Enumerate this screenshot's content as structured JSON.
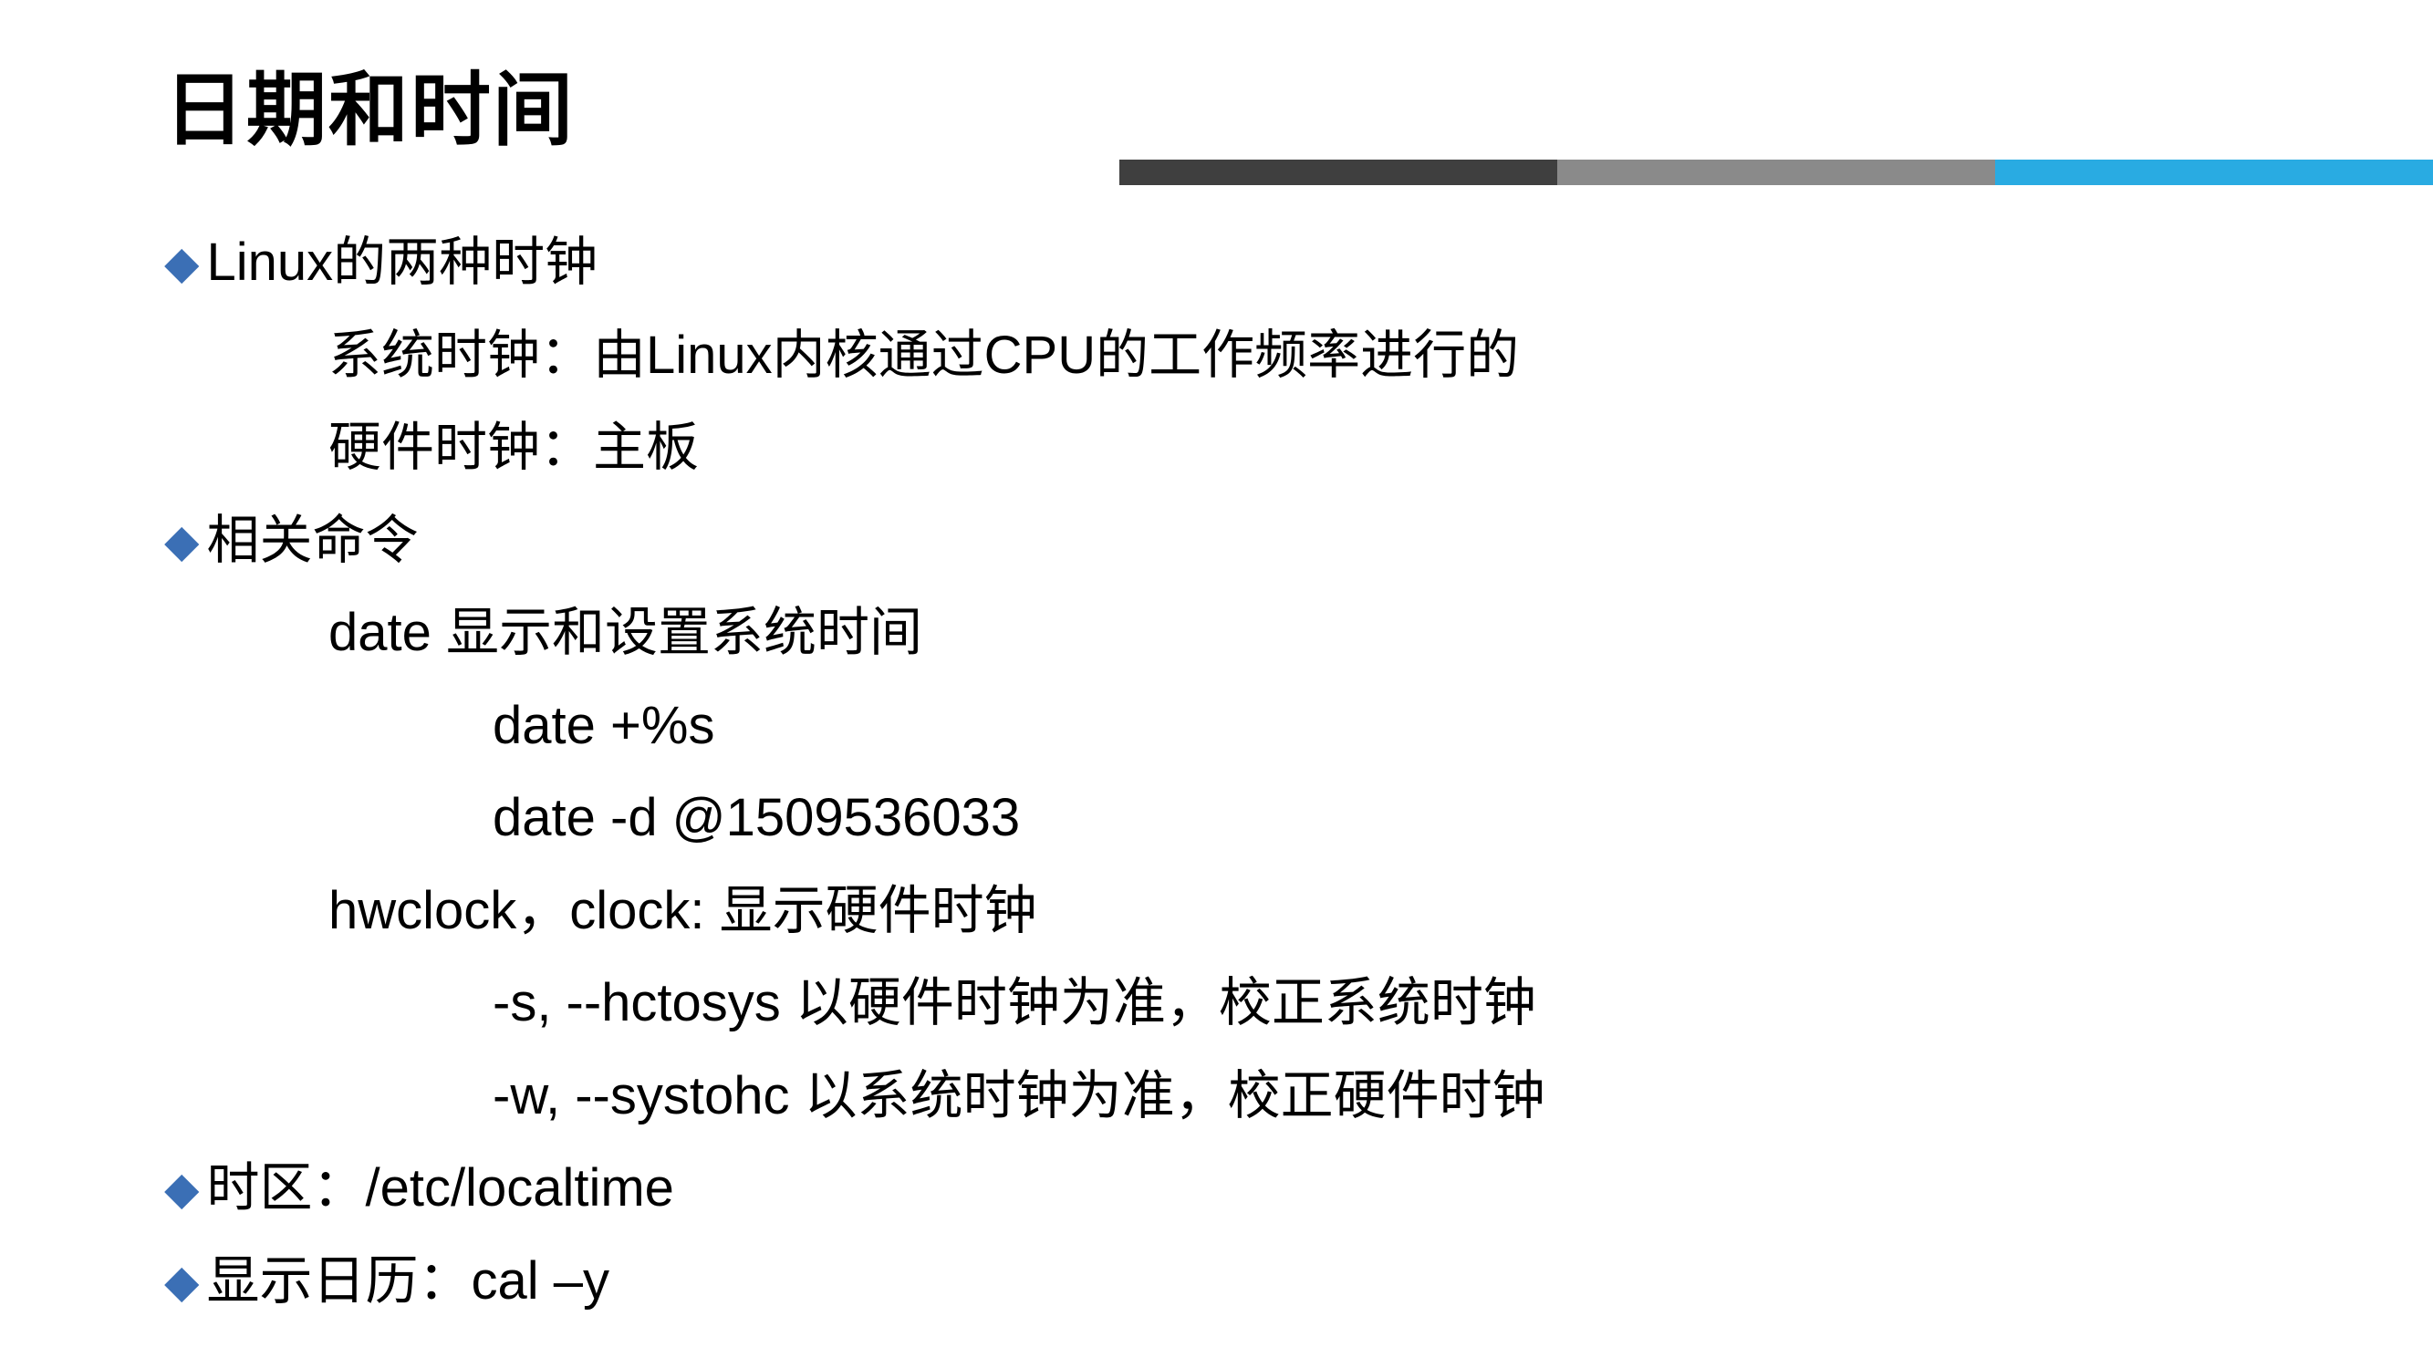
{
  "title": "日期和时间",
  "bullets": {
    "b1": {
      "label": "Linux的两种时钟",
      "sub1": "系统时钟：由Linux内核通过CPU的工作频率进行的",
      "sub2": "硬件时钟：主板"
    },
    "b2": {
      "label": "相关命令",
      "sub1": "date  显示和设置系统时间",
      "sub1a": "date +%s",
      "sub1b": "date -d @1509536033",
      "sub2": "hwclock，clock: 显示硬件时钟",
      "sub2a": "-s, --hctosys 以硬件时钟为准，校正系统时钟",
      "sub2b": "-w, --systohc 以系统时钟为准，校正硬件时钟"
    },
    "b3": {
      "label": "时区：/etc/localtime"
    },
    "b4": {
      "label": "显示日历：cal –y"
    }
  }
}
